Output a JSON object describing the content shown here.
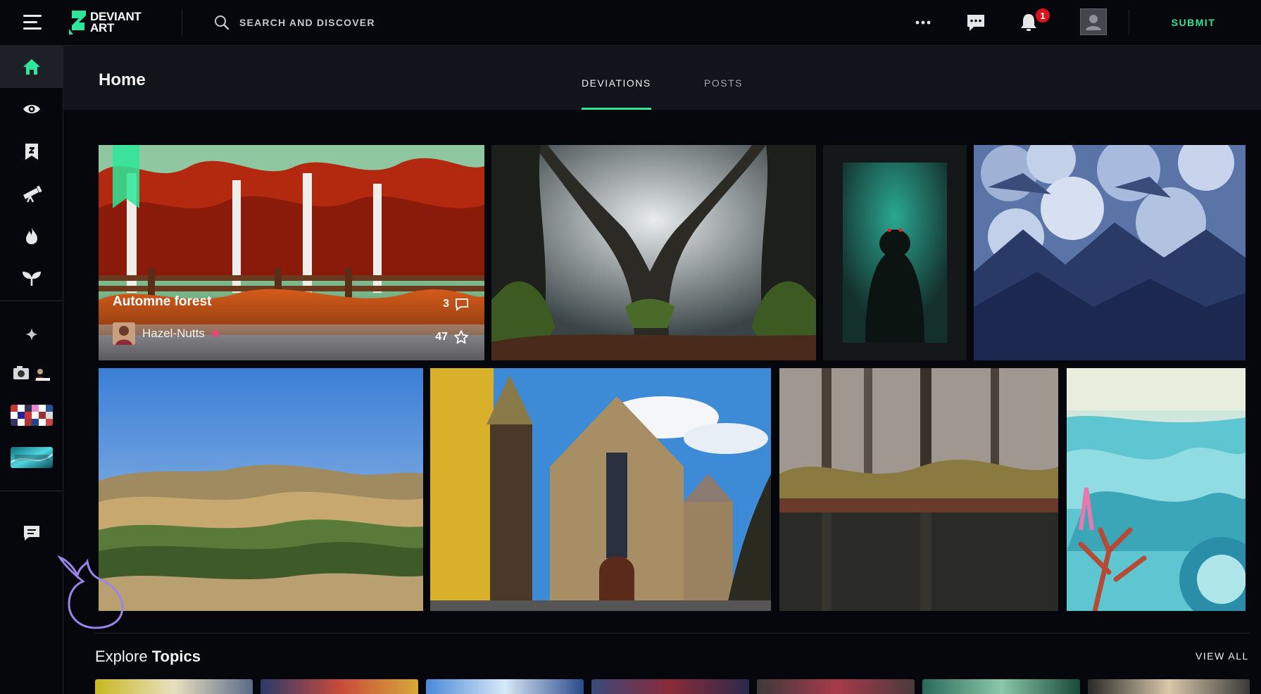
{
  "app": {
    "logo_text": "DEVIANT\nART",
    "search_placeholder": "SEARCH AND DISCOVER",
    "notification_count": "1",
    "submit_label": "SUBMIT",
    "accent_color": "#2de699"
  },
  "sidebar": {
    "items": [
      {
        "icon": "home-icon",
        "active": true
      },
      {
        "icon": "eye-icon"
      },
      {
        "icon": "deviantart-bookmark-icon"
      },
      {
        "icon": "telescope-icon"
      },
      {
        "icon": "fire-icon"
      },
      {
        "icon": "sprout-icon"
      }
    ],
    "groups": [
      {
        "icon": "sparkle-icon"
      },
      {
        "icon": "group-camera-icon"
      },
      {
        "icon": "group-mosaic-icon"
      },
      {
        "icon": "group-through-the-lens-icon"
      }
    ],
    "chat_icon": "chat-bubble-icon"
  },
  "header": {
    "title": "Home",
    "tabs": [
      {
        "label": "DEVIATIONS",
        "active": true
      },
      {
        "label": "POSTS",
        "active": false
      }
    ]
  },
  "featured": {
    "title": "Automne forest",
    "comments": "3",
    "author": "Hazel-Nutts",
    "favourites": "47"
  },
  "explore": {
    "prefix": "Explore",
    "bold": "Topics",
    "view_all": "VIEW ALL"
  }
}
